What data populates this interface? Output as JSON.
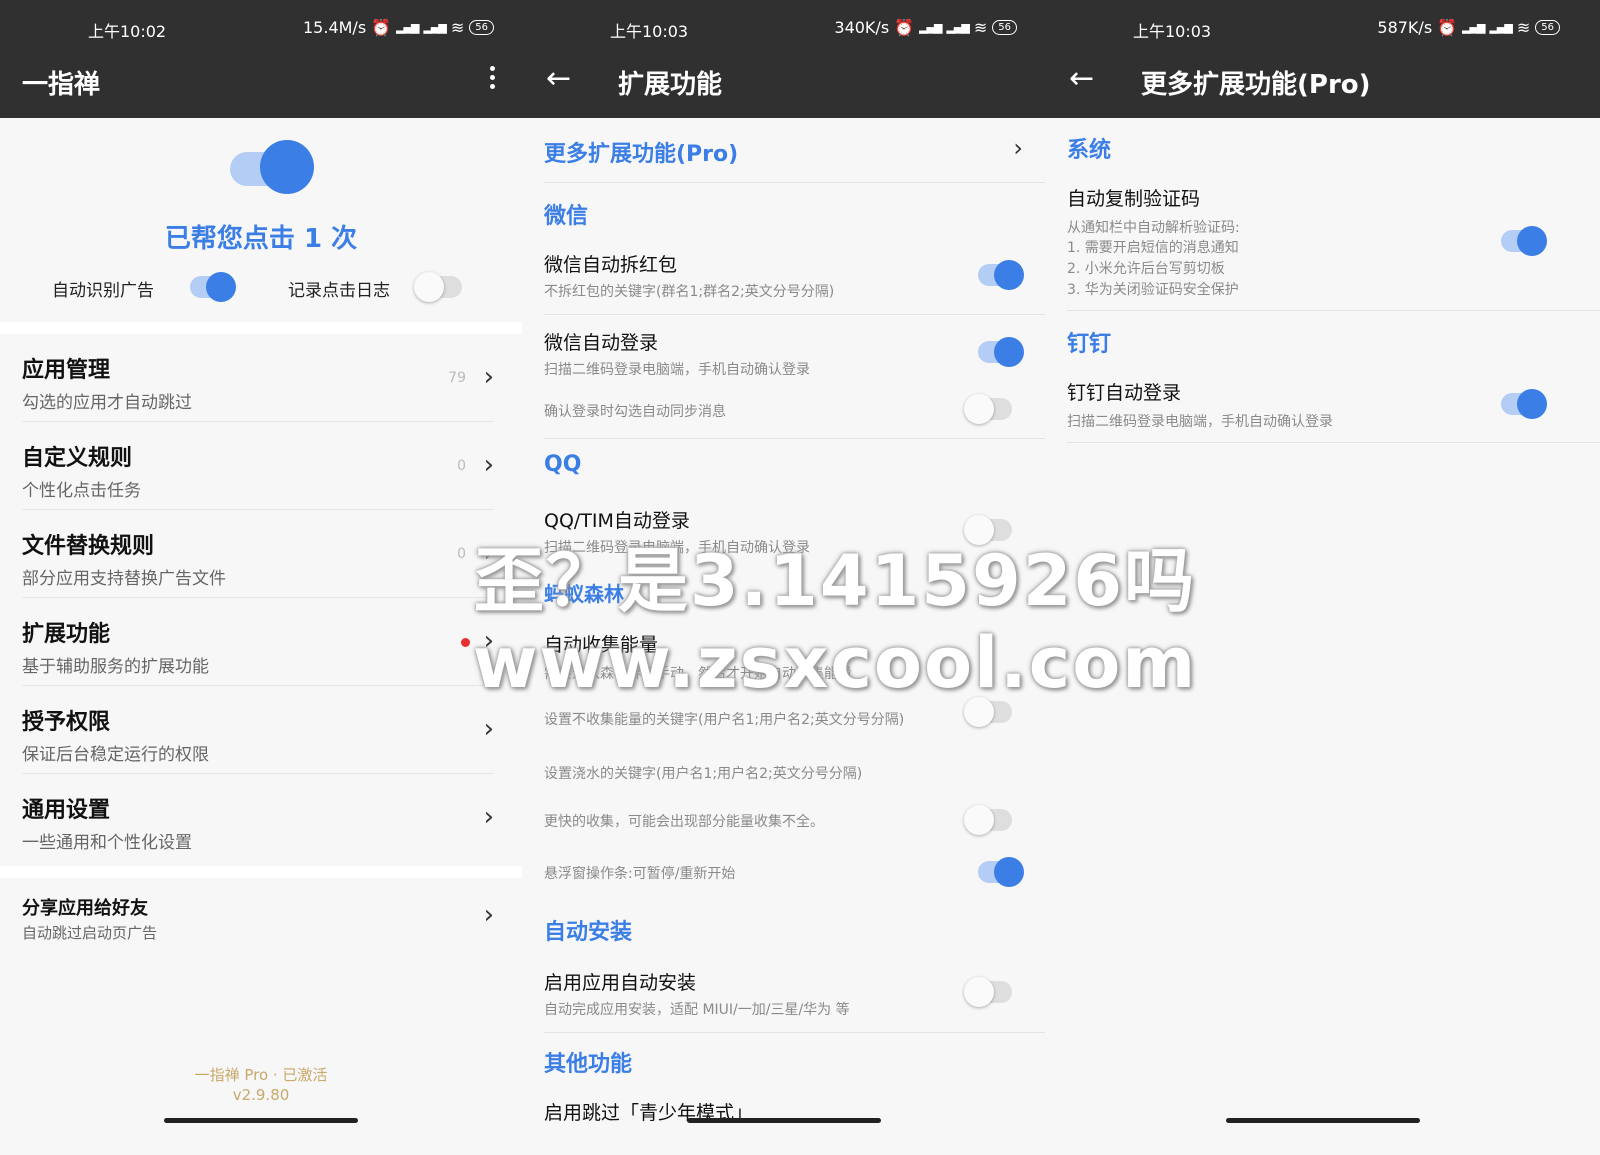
{
  "screen1": {
    "status": {
      "time": "上午10:02",
      "speed": "15.4M/s",
      "signal": "ᴴᴰ",
      "battery": "56"
    },
    "title": "一指禅",
    "click_count_text": "已帮您点击 1 次",
    "auto_detect_label": "自动识别广告",
    "auto_detect_on": true,
    "log_label": "记录点击日志",
    "log_on": false,
    "menu": [
      {
        "title": "应用管理",
        "subtitle": "勾选的应用才自动跳过",
        "count": "79"
      },
      {
        "title": "自定义规则",
        "subtitle": "个性化点击任务",
        "count": "0"
      },
      {
        "title": "文件替换规则",
        "subtitle": "部分应用支持替换广告文件",
        "count": "0"
      },
      {
        "title": "扩展功能",
        "subtitle": "基于辅助服务的扩展功能",
        "count": ""
      },
      {
        "title": "授予权限",
        "subtitle": "保证后台稳定运行的权限",
        "count": ""
      },
      {
        "title": "通用设置",
        "subtitle": "一些通用和个性化设置",
        "count": ""
      }
    ],
    "share": {
      "title": "分享应用给好友",
      "subtitle": "自动跳过启动页广告"
    },
    "footer_line1": "一指禅 Pro · 已激活",
    "footer_line2": "v2.9.80"
  },
  "screen2": {
    "status": {
      "time": "上午10:03",
      "speed": "340K/s",
      "battery": "56"
    },
    "title": "扩展功能",
    "pro_link": "更多扩展功能(Pro)",
    "wechat_header": "微信",
    "wechat_redpack": "微信自动拆红包",
    "wechat_redpack_desc": "不拆红包的关键字(群名1;群名2;英文分号分隔)",
    "wechat_login": "微信自动登录",
    "wechat_login_desc": "扫描二维码登录电脑端，手机自动确认登录",
    "wechat_sync_desc": "确认登录时勾选自动同步消息",
    "qq_header": "QQ",
    "qq_login": "QQ/TIM自动登录",
    "qq_login_desc": "扫描二维码登录电脑端，手机自动确认登录",
    "ant_header": "蚂蚁森林",
    "ant_collect": "自动收集能量",
    "ant_collect_desc": "需要进入森林界面手动，然后才开始自动收集能量",
    "ant_skip_desc": "设置不收集能量的关键字(用户名1;用户名2;英文分号分隔)",
    "ant_water_desc": "设置浇水的关键字(用户名1;用户名2;英文分号分隔)",
    "ant_fast_desc": "更快的收集，可能会出现部分能量收集不全。",
    "ant_float_desc": "悬浮窗操作条:可暂停/重新开始",
    "install_header": "自动安装",
    "install_title": "启用应用自动安装",
    "install_desc": "自动完成应用安装，适配 MIUI/一加/三星/华为 等",
    "other_header": "其他功能",
    "other_item": "启用跳过「青少年模式」"
  },
  "screen3": {
    "status": {
      "time": "上午10:03",
      "speed": "587K/s",
      "battery": "56"
    },
    "title": "更多扩展功能(Pro)",
    "system_header": "系统",
    "sms_title": "自动复制验证码",
    "sms_desc": [
      "从通知栏中自动解析验证码:",
      "1. 需要开启短信的消息通知",
      "2. 小米允许后台写剪切板",
      "3. 华为关闭验证码安全保护"
    ],
    "ding_header": "钉钉",
    "ding_title": "钉钉自动登录",
    "ding_desc": "扫描二维码登录电脑端，手机自动确认登录"
  },
  "watermark": {
    "line1": "歪？是3.1415926吗",
    "line2": "www.zsxcool.com"
  },
  "colors": {
    "accent": "#3a7ee6",
    "appbar": "#303030",
    "footer": "#c8a96a"
  }
}
